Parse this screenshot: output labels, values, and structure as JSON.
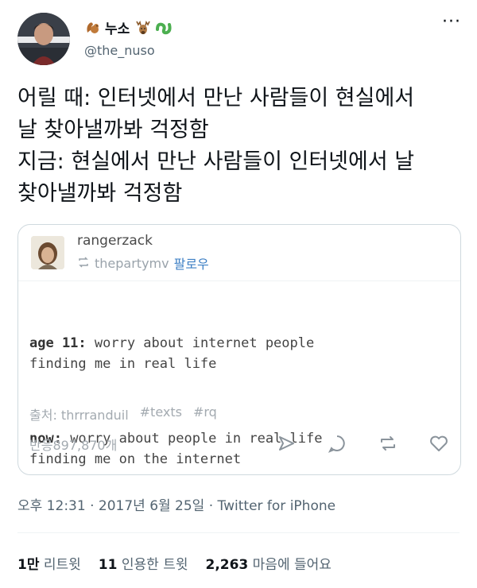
{
  "author": {
    "display_name": "누소",
    "handle": "@the_nuso",
    "emoji_before": "squirrel",
    "emoji_after": [
      "deer",
      "worm"
    ]
  },
  "tweet": {
    "lines": [
      "어릴 때: 인터넷에서 만난 사람들이 현실에서",
      "날 찾아낼까봐 걱정함",
      "지금: 현실에서 만난 사람들이 인터넷에서 날",
      "찾아낼까봐 걱정함"
    ]
  },
  "card": {
    "username": "rangerzack",
    "reblog_from": "thepartymv",
    "follow_label": "팔로우",
    "post": [
      {
        "bold": "age 11:",
        "text": " worry about internet people",
        "line2": "finding me in real life"
      },
      {
        "bold": "now:",
        "text": " worry about people in real life",
        "line2": "finding me on the internet"
      }
    ],
    "source_label": "출처: thrrranduil",
    "tags": [
      "#texts",
      "#rq"
    ],
    "notes": "반응897,870개"
  },
  "timestamp": "오후 12:31 · 2017년 6월 25일 · Twitter for iPhone",
  "stats": {
    "retweets_value": "1만",
    "retweets_label": "리트윗",
    "quotes_value": "11",
    "quotes_label": "인용한 트윗",
    "likes_value": "2,263",
    "likes_label": "마음에 들어요"
  },
  "colors": {
    "text": "#0f1419",
    "secondary": "#536471",
    "card_border": "#cfd9de",
    "follow_blue": "#3d7fc4",
    "tumblr_gray": "#a3aab0"
  }
}
